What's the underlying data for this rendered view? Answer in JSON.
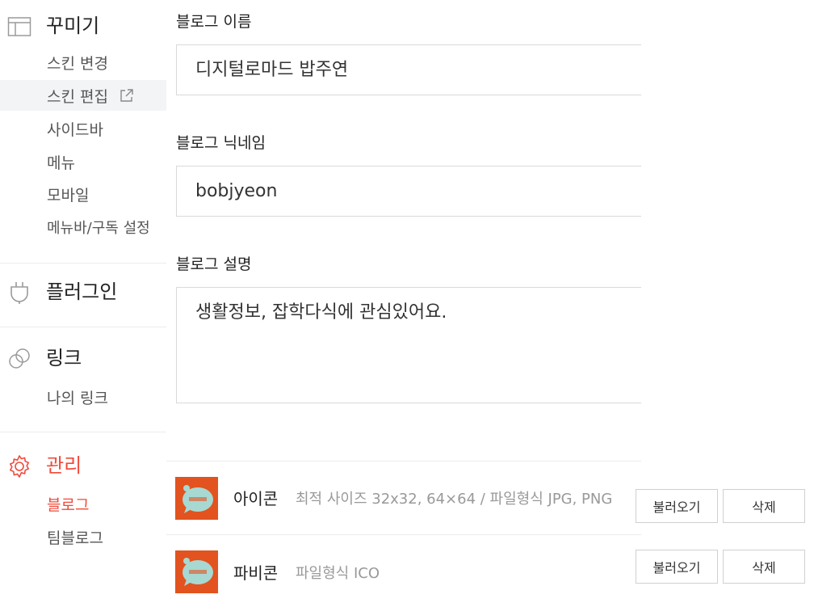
{
  "sidebar": {
    "decorate": {
      "title": "꾸미기",
      "items": [
        "스킨 변경",
        "스킨 편집",
        "사이드바",
        "메뉴",
        "모바일",
        "메뉴바/구독 설정"
      ]
    },
    "plugin": {
      "title": "플러그인"
    },
    "link": {
      "title": "링크",
      "items": [
        "나의 링크"
      ]
    },
    "manage": {
      "title": "관리",
      "items": [
        "블로그",
        "팀블로그"
      ]
    }
  },
  "form": {
    "name_label": "블로그 이름",
    "name_value": "디지털로마드 밥주연",
    "nick_label": "블로그 닉네임",
    "nick_value": "bobjyeon",
    "desc_label": "블로그 설명",
    "desc_value": "생활정보, 잡학다식에 관심있어요."
  },
  "icon_row": {
    "title": "아이콘",
    "desc": "최적 사이즈 32x32, 64×64 / 파일형식 JPG, PNG",
    "load_label": "불러오기",
    "delete_label": "삭제"
  },
  "favicon_row": {
    "title": "파비콘",
    "desc": "파일형식 ICO",
    "load_label": "불러오기",
    "delete_label": "삭제"
  },
  "colors": {
    "accent": "#f04a3a",
    "thumb": "#e2531f",
    "active_bg": "#f3f4f5"
  }
}
